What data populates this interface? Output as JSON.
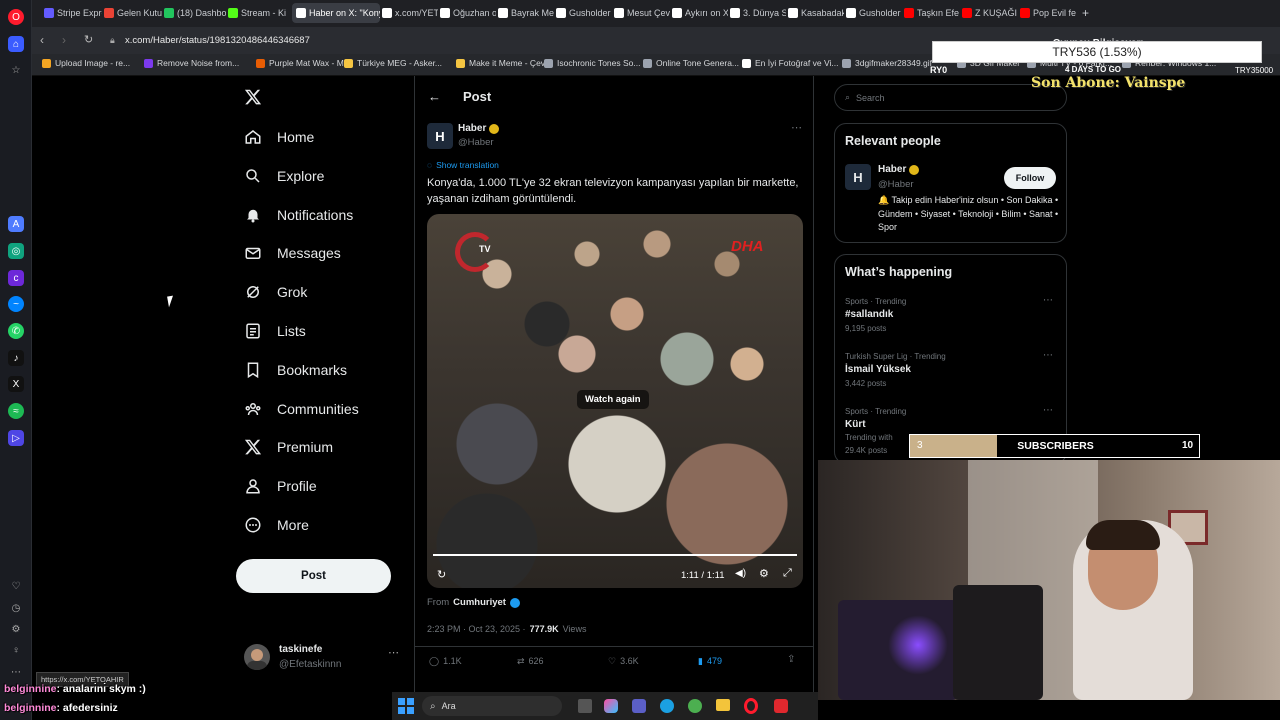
{
  "browser": {
    "tabs": [
      {
        "label": "Stripe Expre",
        "color": "#635bff"
      },
      {
        "label": "Gelen Kutu",
        "color": "#ea4335"
      },
      {
        "label": "(18) Dashbo",
        "color": "#22c55e"
      },
      {
        "label": "Stream - Ki",
        "color": "#53fc18"
      },
      {
        "label": "Haber on X: \"Konya",
        "color": "#ffffff",
        "active": true
      },
      {
        "label": "x.com/YETO",
        "color": "#ffffff"
      },
      {
        "label": "Oğuzhan or",
        "color": "#ffffff"
      },
      {
        "label": "Bayrak Med",
        "color": "#ffffff"
      },
      {
        "label": "Gusholder",
        "color": "#ffffff"
      },
      {
        "label": "Mesut Çevi",
        "color": "#ffffff"
      },
      {
        "label": "Aykırı on X",
        "color": "#ffffff"
      },
      {
        "label": "3. Dünya Sa",
        "color": "#ffffff"
      },
      {
        "label": "Kasabadakı",
        "color": "#ffffff"
      },
      {
        "label": "Gusholder",
        "color": "#ffffff"
      },
      {
        "label": "Taşkın Efe",
        "color": "#ff0000"
      },
      {
        "label": "Z KUŞAĞI A",
        "color": "#ff0000"
      },
      {
        "label": "Pop Evil fea",
        "color": "#ff0000"
      }
    ],
    "url": "x.com/Haber/status/1981320486446346687",
    "bookmarks": [
      {
        "label": "Upload Image - re...",
        "color": "#f5a623"
      },
      {
        "label": "Remove Noise from...",
        "color": "#7c3aed"
      },
      {
        "label": "Purple Mat Wax - M...",
        "color": "#e85d04"
      },
      {
        "label": "Türkiye MEG - Asker...",
        "color": "#f5c542"
      },
      {
        "label": "Make it Meme - Çev...",
        "color": "#f5c542"
      },
      {
        "label": "Isochronic Tones So...",
        "color": "#9ca3af"
      },
      {
        "label": "Online Tone Genera...",
        "color": "#9ca3af"
      },
      {
        "label": "En İyi Fotoğraf ve Vi...",
        "color": "#ffffff"
      },
      {
        "label": "3dgifmaker28349.gif",
        "color": "#9ca3af"
      },
      {
        "label": "3D Gif Maker",
        "color": "#9ca3af"
      },
      {
        "label": "Multi TV - 6 Farkı...",
        "color": "#9ca3af"
      },
      {
        "label": "Rehber: Windows 1...",
        "color": "#9ca3af"
      }
    ],
    "status_url": "https://x.com/YETOAHIR"
  },
  "nav": {
    "items": [
      {
        "label": "Home",
        "icon": "home-icon"
      },
      {
        "label": "Explore",
        "icon": "search-icon"
      },
      {
        "label": "Notifications",
        "icon": "bell-icon"
      },
      {
        "label": "Messages",
        "icon": "mail-icon"
      },
      {
        "label": "Grok",
        "icon": "grok-icon"
      },
      {
        "label": "Lists",
        "icon": "list-icon"
      },
      {
        "label": "Bookmarks",
        "icon": "bookmark-icon"
      },
      {
        "label": "Communities",
        "icon": "people-icon"
      },
      {
        "label": "Premium",
        "icon": "x-logo-icon"
      },
      {
        "label": "Profile",
        "icon": "person-icon"
      },
      {
        "label": "More",
        "icon": "more-circle-icon"
      }
    ],
    "post_button": "Post",
    "account": {
      "name": "taskinefe",
      "handle": "@Efetaskinnn"
    }
  },
  "post": {
    "header": "Post",
    "author": {
      "name": "Haber",
      "handle": "@Haber",
      "avatar_letter": "H"
    },
    "show_translation": "Show translation",
    "text": "Konya'da, 1.000 TL'ye 32 ekran televizyon kampanyası yapılan bir markette, yaşanan izdiham görüntülendi.",
    "video": {
      "watch_again": "Watch again",
      "time": "1:11 / 1:11",
      "progress": 1.0,
      "logo_left": "TV",
      "logo_right": "DHA"
    },
    "from_label": "From",
    "from_source": "Cumhuriyet",
    "time": "2:23 PM · Oct 23, 2025 ·",
    "views_count": "777.9K",
    "views_label": "Views",
    "stats": {
      "replies": "1.1K",
      "reposts": "626",
      "likes": "3.6K",
      "bookmarks": "479"
    }
  },
  "right": {
    "search_placeholder": "Search",
    "relevant_title": "Relevant people",
    "person": {
      "name": "Haber",
      "handle": "@Haber",
      "follow": "Follow",
      "bio": "🔔 Takip edin Haber'iniz olsun • Son Dakika • Gündem • Siyaset • Teknoloji • Bilim • Sanat • Spor"
    },
    "happening_title": "What’s happening",
    "trends": [
      {
        "context": "Sports · Trending",
        "name": "#sallandık",
        "posts": "9,195 posts"
      },
      {
        "context": "Turkish Super Lig · Trending",
        "name": "İsmail Yüksek",
        "posts": "3,442 posts"
      },
      {
        "context": "Sports · Trending",
        "name": "Kürt",
        "posts": "29.4K posts",
        "extra": "Trending with"
      }
    ]
  },
  "overlay": {
    "goal_title": "Oyuncu Bilgisayarı",
    "goal_amount": "TRY536 (1.53%)",
    "goal_left": "RY0",
    "goal_days": "4 DAYS TO GO",
    "goal_right": "TRY35000",
    "last_sub": "Son Abone: Vainspe",
    "sub_count": "3",
    "sub_label": "SUBSCRIBERS",
    "sub_goal": "10",
    "sub_progress": 0.3
  },
  "chat": [
    {
      "user": "belginnine",
      "msg": ": anaları̇nı̇ skym :)"
    },
    {
      "user": "belginnine",
      "msg": ": afedersiniz"
    }
  ],
  "taskbar": {
    "search": "Ara"
  }
}
